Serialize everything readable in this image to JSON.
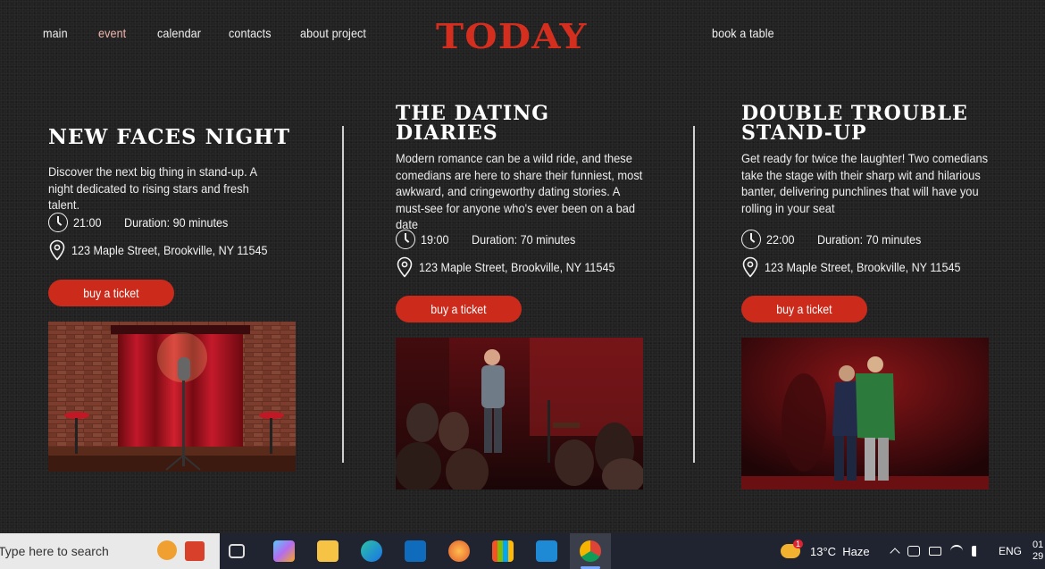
{
  "nav": {
    "items": [
      "main",
      "event",
      "calendar",
      "contacts",
      "about project"
    ],
    "active": "event",
    "logo": "TODAY",
    "book": "book a table"
  },
  "events": [
    {
      "title_lines": [
        "New Faces Night"
      ],
      "description": "Discover the next big thing in stand-up. A night dedicated to rising stars and fresh talent.",
      "time": "21:00",
      "duration": "Duration: 90 minutes",
      "address": "123 Maple Street, Brookville, NY 11545",
      "button": "buy a ticket"
    },
    {
      "title_lines": [
        "The Dating",
        "Diaries"
      ],
      "description": "Modern romance can be a wild ride, and these comedians are here to share their funniest, most awkward, and cringeworthy dating stories. A must-see for anyone who's ever been on a bad date",
      "time": "19:00",
      "duration": "Duration: 70 minutes",
      "address": "123 Maple Street, Brookville, NY 11545",
      "button": "buy a ticket"
    },
    {
      "title_lines": [
        "Double Trouble",
        "Stand-Up"
      ],
      "description": "Get ready for twice the laughter! Two comedians take the stage with their sharp wit and hilarious banter, delivering punchlines that will have you rolling in your seat",
      "time": "22:00",
      "duration": "Duration: 70 minutes",
      "address": "123 Maple Street, Brookville, NY 11545",
      "button": "buy a ticket"
    }
  ],
  "taskbar": {
    "search_placeholder": "Type here to search",
    "weather": "13°C  Haze",
    "lang": "ENG",
    "notification_count": "1",
    "clock_line1": "01",
    "clock_line2": "29"
  },
  "colors": {
    "accent": "#cc2a1b",
    "logo": "#d42e1e",
    "background": "#222222"
  }
}
